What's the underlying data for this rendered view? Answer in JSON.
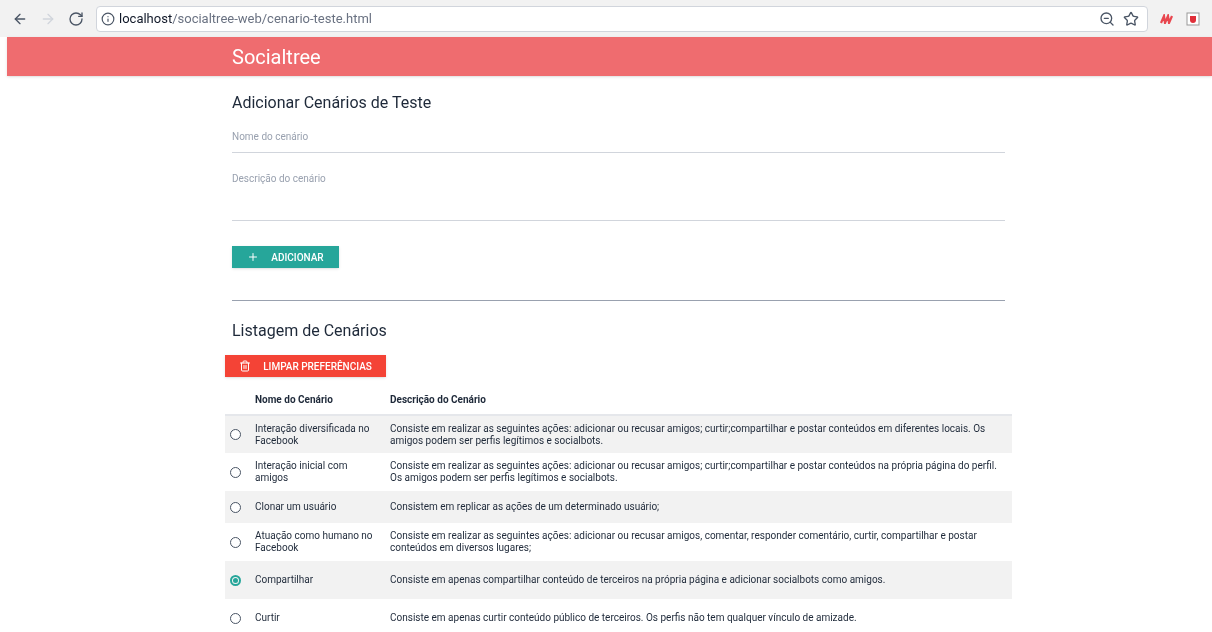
{
  "browser": {
    "url_host": "localhost",
    "url_path": "/socialtree-web/cenario-teste.html"
  },
  "app_bar": {
    "title": "Socialtree"
  },
  "add_section": {
    "title": "Adicionar Cenários de Teste",
    "name_field": {
      "placeholder": "Nome do cenário"
    },
    "description_field": {
      "placeholder": "Descrição do cenário"
    },
    "add_button": "ADICIONAR"
  },
  "list_section": {
    "title": "Listagem de Cenários",
    "clear_button": "LIMPAR PREFERÊNCIAS",
    "table": {
      "columns": [
        "Nome do Cenário",
        "Descrição do Cenário"
      ],
      "rows": [
        {
          "name": "Interação diversificada no Facebook",
          "description": "Consiste em realizar as seguintes ações: adicionar ou recusar amigos; curtir;compartilhar e postar conteúdos em diferentes locais. Os amigos podem ser perfis legítimos e socialbots.",
          "selected": false
        },
        {
          "name": "Interação inicial com amigos",
          "description": "Consiste em realizar as seguintes ações: adicionar ou recusar amigos; curtir;compartilhar e postar conteúdos na própria página do perfil. Os amigos podem ser perfis legítimos e socialbots.",
          "selected": false
        },
        {
          "name": "Clonar um usuário",
          "description": "Consistem em replicar as ações de um determinado usuário;",
          "selected": false
        },
        {
          "name": "Atuação como humano no Facebook",
          "description": "Consiste em realizar as seguintes ações: adicionar ou recusar amigos, comentar, responder comentário, curtir, compartilhar e postar conteúdos em diversos lugares;",
          "selected": false
        },
        {
          "name": "Compartilhar",
          "description": "Consiste em apenas compartilhar conteúdo de terceiros na própria página e adicionar socialbots como amigos.",
          "selected": true
        },
        {
          "name": "Curtir",
          "description": "Consiste em apenas curtir conteúdo público de terceiros. Os perfis não tem qualquer vínculo de amizade.",
          "selected": false
        }
      ]
    }
  }
}
